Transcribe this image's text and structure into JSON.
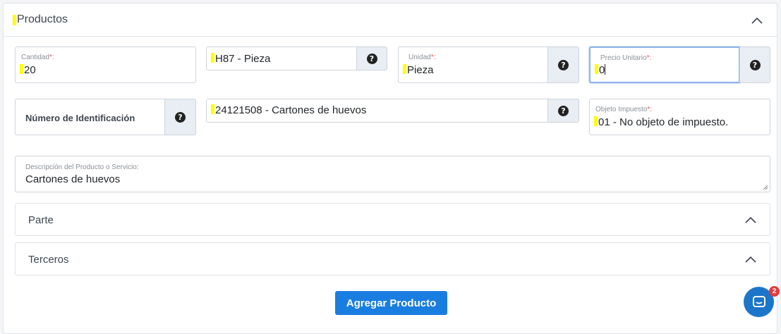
{
  "section": {
    "title": "Productos"
  },
  "fields": {
    "cantidad": {
      "label": "Cantidad",
      "required": "*:",
      "value": "20"
    },
    "clave_unidad": {
      "value": "H87 - Pieza"
    },
    "unidad": {
      "label": "Unidad",
      "required": "*:",
      "value": "Pieza"
    },
    "precio_unitario": {
      "label": "Precio Unitario",
      "required": "*:",
      "value": "0"
    },
    "numero_identificacion": {
      "label": "Número de Identificación"
    },
    "clave_producto": {
      "value": "24121508 - Cartones de huevos"
    },
    "objeto_impuesto": {
      "label": "Objeto Impuesto",
      "required": "*:",
      "value": "01 - No objeto de impuesto."
    },
    "descripcion": {
      "label": "Descripción del Producto o Servicio:",
      "value": "Cartones de huevos"
    }
  },
  "help_icon": "?",
  "sections": {
    "parte": {
      "title": "Parte"
    },
    "terceros": {
      "title": "Terceros"
    }
  },
  "actions": {
    "add_product_label": "Agregar Producto"
  },
  "chat": {
    "badge_count": "2"
  },
  "colors": {
    "primary": "#1a7de0",
    "highlight": "#ffff00",
    "required": "#e05b5b",
    "addon_bg": "#e9eef5",
    "badge": "#e23b3b"
  },
  "icons": {
    "collapse": "chevron-up-icon",
    "help": "question-circle-icon",
    "chat": "chat-bubble-icon"
  }
}
